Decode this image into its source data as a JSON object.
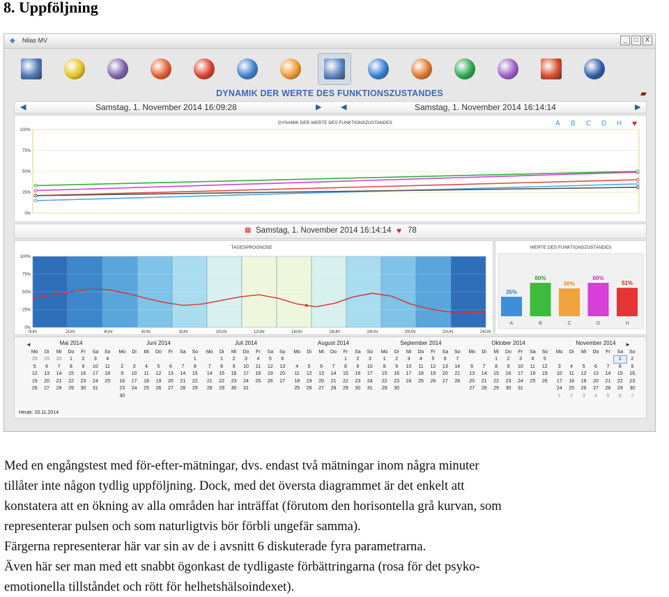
{
  "heading": "8. Uppföljning",
  "window": {
    "title": "Nilas MV",
    "buttons": [
      "_",
      "□",
      "X"
    ]
  },
  "toolbar": {
    "tools": [
      {
        "name": "cardiogram-icon",
        "color": "#4a78b8"
      },
      {
        "name": "energy-sphere-icon",
        "color": "#e3c21a"
      },
      {
        "name": "particles-icon",
        "color": "#7a5fa8"
      },
      {
        "name": "hexagons-icon",
        "color": "#e05a2a"
      },
      {
        "name": "body-map-icon",
        "color": "#d93c2b"
      },
      {
        "name": "chakra-square-icon",
        "color": "#3b7dcc"
      },
      {
        "name": "pie-chart-icon",
        "color": "#f2962a"
      },
      {
        "name": "dynamics-chart-icon",
        "color": "#5a84c2"
      },
      {
        "name": "head-profile-icon",
        "color": "#2f7ecf"
      },
      {
        "name": "om-icon",
        "color": "#e0742a"
      },
      {
        "name": "yin-yang-icon",
        "color": "#26a64a"
      },
      {
        "name": "pentagon-icon",
        "color": "#9a5bc4"
      },
      {
        "name": "bar-chart-icon",
        "color": "#d94b2c"
      },
      {
        "name": "globe-icon",
        "color": "#2c5aa8"
      }
    ],
    "selected_index": 7
  },
  "banner": "DYNAMIK DER WERTE DES FUNKTIONSZUSTANDES",
  "nav": {
    "left_date": "Samstag, 1. November 2014 16:09:28",
    "right_date": "Samstag, 1. November 2014 16:14:14"
  },
  "top_chart": {
    "title": "DYNAMIK DER WERTE DES FUNKTIONSZUSTANDES",
    "yticks": [
      "100%",
      "75%",
      "50%",
      "25%",
      "0%"
    ],
    "legend": [
      "A",
      "B",
      "C",
      "D",
      "H"
    ],
    "legend_colors": [
      "#4d8de0",
      "#4d8de0",
      "#4d8de0",
      "#4d8de0",
      "#4d8de0"
    ],
    "heart_icon": "heart-icon",
    "chart_data": {
      "type": "line",
      "x": [
        "Samstag, 1. November 2014 16:09:28",
        "Samstag, 1. November 2014 16:14:14"
      ],
      "ylim": [
        0,
        100
      ],
      "series": [
        {
          "values": [
            15,
            35
          ],
          "color": "#4aa8e8"
        },
        {
          "values": [
            27,
            49
          ],
          "color": "#d23fd6"
        },
        {
          "values": [
            33,
            50
          ],
          "color": "#2bb33b"
        },
        {
          "values": [
            21,
            40
          ],
          "color": "#e24a4a"
        },
        {
          "values": [
            21,
            31
          ],
          "color": "#555555"
        }
      ]
    }
  },
  "mid": {
    "date": "Samstag, 1. November 2014 16:14:14",
    "pulse": "78"
  },
  "day_chart": {
    "title": "TAGESPROGNOSE",
    "yticks": [
      "100%",
      "75%",
      "50%",
      "25%",
      "0%"
    ],
    "xticks": [
      "0Uhr",
      "2Uhr",
      "4Uhr",
      "6Uhr",
      "8Uhr",
      "10Uhr",
      "12Uhr",
      "14Uhr",
      "16Uhr",
      "18Uhr",
      "20Uhr",
      "22Uhr",
      "24Uhr"
    ],
    "band_colors": [
      "#2f6fb9",
      "#3e86cc",
      "#5aa6dc",
      "#7fc3e8",
      "#a9dcef",
      "#d8f0ee",
      "#eef7dc",
      "#eef7dc",
      "#d8f0ee",
      "#a9dcef",
      "#7fc3e8",
      "#5aa6dc",
      "#2f6fb9"
    ],
    "chart_data": {
      "type": "line",
      "x": [
        0,
        1,
        2,
        3,
        4,
        5,
        6,
        7,
        8,
        9,
        10,
        11,
        12,
        13,
        14,
        15,
        16,
        17,
        18,
        19,
        20,
        21,
        22,
        23,
        24
      ],
      "series": [
        {
          "values": [
            41,
            45,
            50,
            54,
            53,
            48,
            41,
            35,
            31,
            33,
            38,
            43,
            46,
            41,
            33,
            29,
            34,
            43,
            48,
            44,
            33,
            26,
            22,
            21,
            21
          ],
          "color": "#d93232"
        }
      ],
      "ylim": [
        0,
        100
      ]
    }
  },
  "bars": {
    "title": "WERTE DES FUNKTIONSZUSTANDES",
    "chart_data": {
      "type": "bar",
      "categories": [
        "A",
        "B",
        "C",
        "D",
        "H"
      ],
      "values": [
        35,
        60,
        50,
        60,
        51
      ],
      "labels": [
        "35%",
        "60%",
        "50%",
        "60%",
        "51%"
      ],
      "colors": [
        "#3d8fdb",
        "#3dbb3d",
        "#f0a33a",
        "#d63fd8",
        "#e53434"
      ],
      "label_colors": [
        "#2d7cc8",
        "#2a9a2a",
        "#e08b1a",
        "#c52fc7",
        "#d32020"
      ],
      "ylim": [
        0,
        100
      ]
    }
  },
  "calendar": {
    "today": "Heute: 20.11.2014",
    "prev": "◄",
    "next": "►",
    "weekdays": [
      "Mo",
      "Di",
      "Mi",
      "Do",
      "Fr",
      "Sa",
      "So"
    ],
    "months": [
      {
        "name": "Mai 2014",
        "rows": [
          [
            "28",
            "29",
            "30",
            "1",
            "2",
            "3",
            "4"
          ],
          [
            "5",
            "6",
            "7",
            "8",
            "9",
            "10",
            "11"
          ],
          [
            "12",
            "13",
            "14",
            "15",
            "16",
            "17",
            "18"
          ],
          [
            "19",
            "20",
            "21",
            "22",
            "23",
            "24",
            "25"
          ],
          [
            "26",
            "27",
            "28",
            "29",
            "30",
            "31",
            ""
          ]
        ],
        "other": [
          [
            0,
            0
          ],
          [
            0,
            1
          ],
          [
            0,
            2
          ]
        ]
      },
      {
        "name": "Juni 2014",
        "rows": [
          [
            "",
            "",
            "",
            "",
            "",
            "",
            "1"
          ],
          [
            "2",
            "3",
            "4",
            "5",
            "6",
            "7",
            "8"
          ],
          [
            "9",
            "10",
            "11",
            "12",
            "13",
            "14",
            "15"
          ],
          [
            "16",
            "17",
            "18",
            "19",
            "20",
            "21",
            "22"
          ],
          [
            "23",
            "24",
            "25",
            "26",
            "27",
            "28",
            "29"
          ],
          [
            "30",
            "",
            "",
            "",
            "",
            "",
            ""
          ]
        ],
        "other": []
      },
      {
        "name": "Juli 2014",
        "rows": [
          [
            "",
            "1",
            "2",
            "3",
            "4",
            "5",
            "6"
          ],
          [
            "7",
            "8",
            "9",
            "10",
            "11",
            "12",
            "13"
          ],
          [
            "14",
            "15",
            "16",
            "17",
            "18",
            "19",
            "20"
          ],
          [
            "21",
            "22",
            "23",
            "24",
            "25",
            "26",
            "27"
          ],
          [
            "28",
            "29",
            "30",
            "31",
            "",
            "",
            ""
          ]
        ],
        "other": []
      },
      {
        "name": "August 2014",
        "rows": [
          [
            "",
            "",
            "",
            "",
            "1",
            "2",
            "3"
          ],
          [
            "4",
            "5",
            "6",
            "7",
            "8",
            "9",
            "10"
          ],
          [
            "11",
            "12",
            "13",
            "14",
            "15",
            "16",
            "17"
          ],
          [
            "18",
            "19",
            "20",
            "21",
            "22",
            "23",
            "24"
          ],
          [
            "25",
            "26",
            "27",
            "28",
            "29",
            "30",
            "31"
          ]
        ],
        "other": []
      },
      {
        "name": "September 2014",
        "rows": [
          [
            "1",
            "2",
            "3",
            "4",
            "5",
            "6",
            "7"
          ],
          [
            "8",
            "9",
            "10",
            "11",
            "12",
            "13",
            "14"
          ],
          [
            "15",
            "16",
            "17",
            "18",
            "19",
            "20",
            "21"
          ],
          [
            "22",
            "23",
            "24",
            "25",
            "26",
            "27",
            "28"
          ],
          [
            "29",
            "30",
            "",
            "",
            "",
            "",
            ""
          ]
        ],
        "other": []
      },
      {
        "name": "Oktober 2014",
        "rows": [
          [
            "",
            "",
            "1",
            "2",
            "3",
            "4",
            "5"
          ],
          [
            "6",
            "7",
            "8",
            "9",
            "10",
            "11",
            "12"
          ],
          [
            "13",
            "14",
            "15",
            "16",
            "17",
            "18",
            "19"
          ],
          [
            "20",
            "21",
            "22",
            "23",
            "24",
            "25",
            "26"
          ],
          [
            "27",
            "28",
            "29",
            "30",
            "31",
            "",
            ""
          ]
        ],
        "other": []
      },
      {
        "name": "November 2014",
        "rows": [
          [
            "",
            "",
            "",
            "",
            "",
            "1",
            "2"
          ],
          [
            "3",
            "4",
            "5",
            "6",
            "7",
            "8",
            "9"
          ],
          [
            "10",
            "11",
            "12",
            "13",
            "14",
            "15",
            "16"
          ],
          [
            "17",
            "18",
            "19",
            "20",
            "21",
            "22",
            "23"
          ],
          [
            "24",
            "25",
            "26",
            "27",
            "28",
            "29",
            "30"
          ],
          [
            "1",
            "2",
            "3",
            "4",
            "5",
            "6",
            "7"
          ]
        ],
        "other": [
          [
            5,
            0
          ],
          [
            5,
            1
          ],
          [
            5,
            2
          ],
          [
            5,
            3
          ],
          [
            5,
            4
          ],
          [
            5,
            5
          ],
          [
            5,
            6
          ]
        ],
        "highlight": [
          0,
          5
        ]
      }
    ]
  },
  "paragraph": [
    "Med en engångstest med för-efter-mätningar, dvs. endast två mätningar inom några minuter",
    "tillåter inte någon tydlig uppföljning. Dock, med det översta diagrammet är det enkelt att",
    "konstatera att en ökning av alla områden har inträffat (förutom den horisontella grå kurvan, som",
    "representerar pulsen och som naturligtvis bör förbli ungefär samma).",
    "Färgerna representerar här var sin av de i avsnitt 6 diskuterade fyra parametrarna.",
    "Även här ser man med ett snabbt ögonkast de tydligaste förbättringarna (rosa för det psyko-",
    "emotionella tillståndet och rött för helhetshälsoindexet)."
  ]
}
